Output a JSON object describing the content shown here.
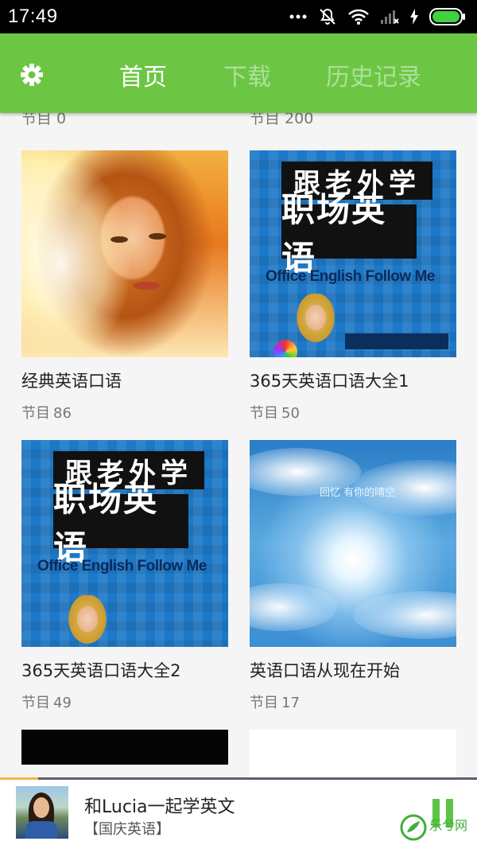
{
  "status_bar": {
    "time": "17:49"
  },
  "header": {
    "tabs": [
      {
        "label": "首页",
        "active": true
      },
      {
        "label": "下载",
        "active": false
      },
      {
        "label": "历史记录",
        "active": false
      }
    ],
    "accent_color": "#6cc644"
  },
  "peek_row": {
    "left": "节目 0",
    "right": "节目 200"
  },
  "cards": [
    {
      "title": "经典英语口语",
      "count_label": "节目",
      "count": "86",
      "cover": "portrait-photo"
    },
    {
      "title": "365天英语口语大全1",
      "count_label": "节目",
      "count": "50",
      "cover": "office-english-cover",
      "cover_text": {
        "top": "跟老外学",
        "mid": "职场英语",
        "en": "Office English Follow Me"
      }
    },
    {
      "title": "365天英语口语大全2",
      "count_label": "节目",
      "count": "49",
      "cover": "office-english-cover",
      "cover_text": {
        "top": "跟老外学",
        "mid": "职场英语",
        "en": "Office English Follow Me"
      }
    },
    {
      "title": "英语口语从现在开始",
      "count_label": "节目",
      "count": "17",
      "cover": "sky-photo",
      "cover_text": {
        "caption": "回忆 有你的晴空"
      }
    }
  ],
  "player": {
    "title": "和Lucia一起学英文",
    "subtitle": "【国庆英语】",
    "progress": 0.08,
    "pause_color": "#5ec447"
  },
  "watermark": {
    "text": "乐兮网"
  }
}
